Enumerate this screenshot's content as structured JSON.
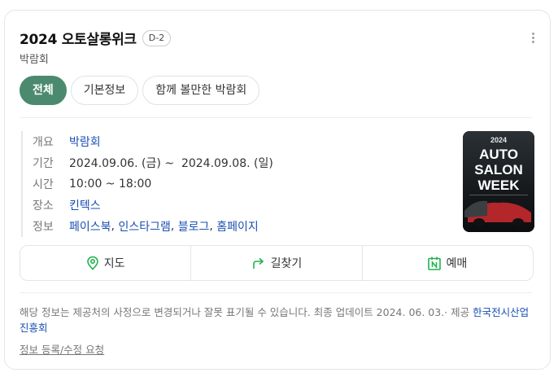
{
  "header": {
    "title": "2024 오토살롱위크",
    "dday": "D-2",
    "subtitle": "박람회"
  },
  "tabs": [
    {
      "label": "전체",
      "active": true
    },
    {
      "label": "기본정보",
      "active": false
    },
    {
      "label": "함께 볼만한 박람회",
      "active": false
    }
  ],
  "info": {
    "overview_label": "개요",
    "overview_value": "박람회",
    "period_label": "기간",
    "period_value": "2024.09.06. (금) ~  2024.09.08. (일)",
    "time_label": "시간",
    "time_value": "10:00 ~ 18:00",
    "place_label": "장소",
    "place_value": "킨텍스",
    "links_label": "정보",
    "links": [
      "페이스북",
      "인스타그램",
      "블로그",
      "홈페이지"
    ],
    "separator": ", "
  },
  "poster": {
    "year": "2024",
    "line1": "AUTO",
    "line2": "SALON",
    "line3": "WEEK",
    "icon": "event-poster-image"
  },
  "actions": {
    "map_label": "지도",
    "directions_label": "길찾기",
    "booking_label": "예매",
    "map_icon": "map-pin-icon",
    "directions_icon": "turn-arrow-icon",
    "booking_icon": "calendar-n-icon"
  },
  "footer": {
    "notice": "해당 정보는 제공처의 사정으로 변경되거나 잘못 표기될 수 있습니다. 최종 업데이트 2024. 06. 03.· 제공",
    "provider": "한국전시산업진흥회",
    "report_link": "정보 등록/수정 요청"
  },
  "colors": {
    "accent_green": "#4b8a6e",
    "link_blue": "#1a4fb3",
    "icon_green": "#1fb24f"
  }
}
